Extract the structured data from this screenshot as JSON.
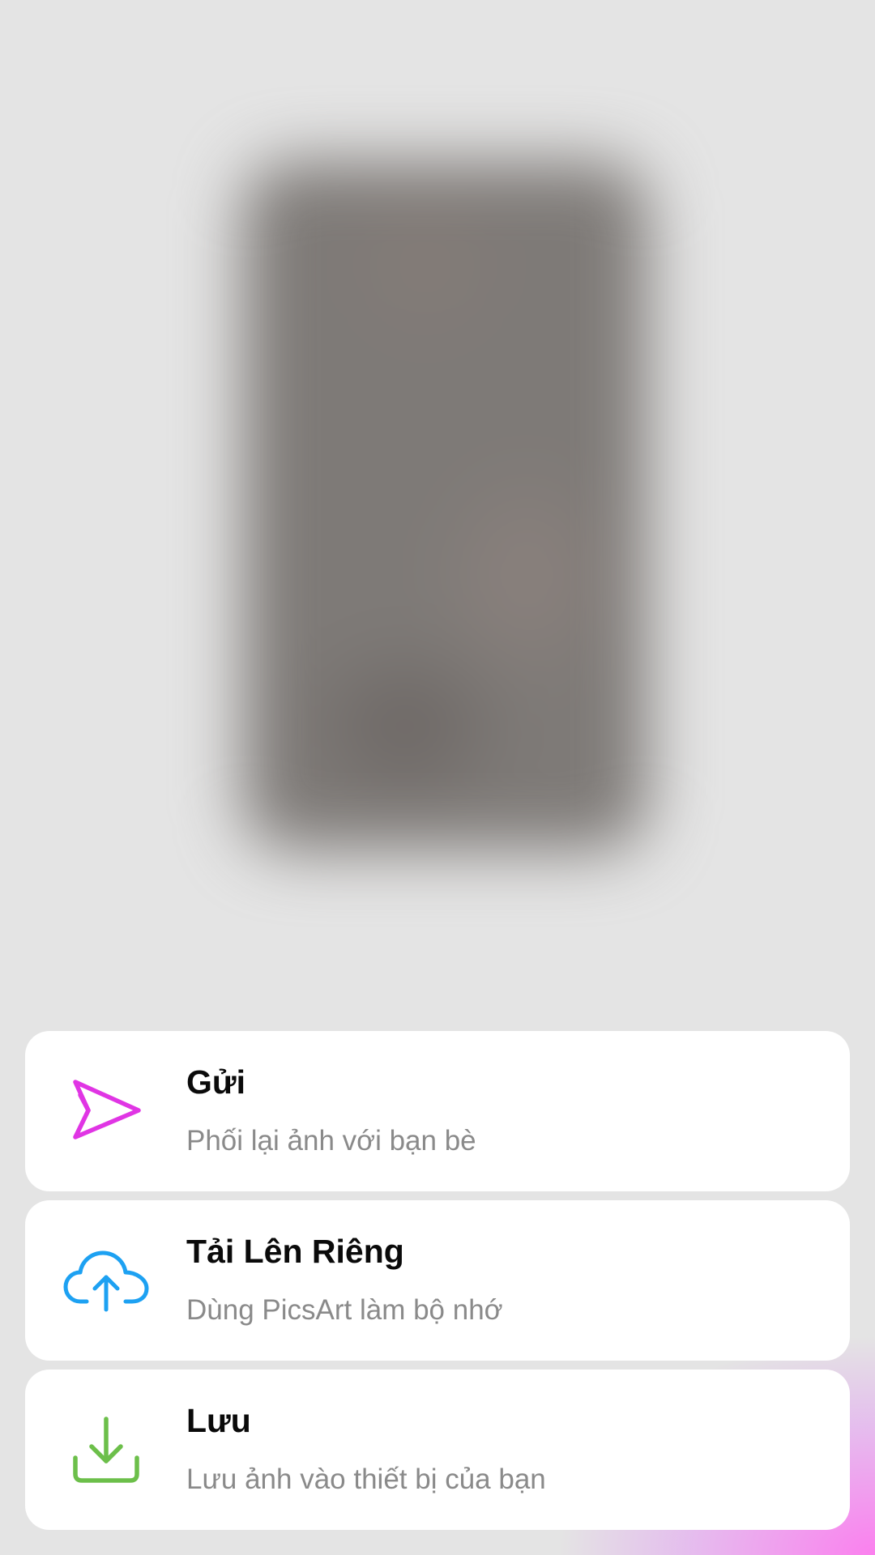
{
  "colors": {
    "send_icon": "#e035e4",
    "upload_icon": "#1da1f2",
    "save_icon": "#6cbf4a",
    "title_text": "#0a0a0a",
    "subtitle_text": "#8a8a8a",
    "card_background": "#ffffff",
    "page_background": "#e4e4e4"
  },
  "preview": {
    "icon": "blurred-image-preview"
  },
  "options": [
    {
      "icon": "send-icon",
      "title": "Gửi",
      "subtitle": "Phối lại ảnh với bạn bè"
    },
    {
      "icon": "cloud-upload-icon",
      "title": "Tải Lên Riêng",
      "subtitle": "Dùng PicsArt làm bộ nhớ"
    },
    {
      "icon": "download-icon",
      "title": "Lưu",
      "subtitle": "Lưu ảnh vào thiết bị của bạn"
    }
  ]
}
